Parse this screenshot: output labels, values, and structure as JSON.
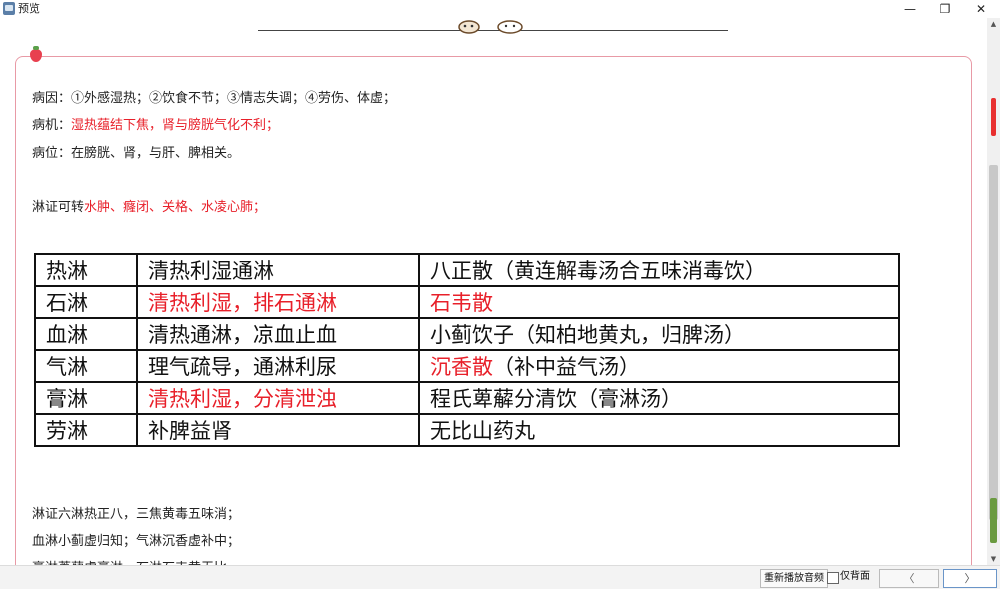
{
  "window": {
    "title": "预览",
    "minimize_glyph": "—",
    "restore_glyph": "❐",
    "close_glyph": "✕"
  },
  "lines": {
    "cause": "病因：①外感湿热；②饮食不节；③情志失调；④劳伤、体虚；",
    "mechanism_label": "病机：",
    "mechanism_value": "湿热蕴结下焦，肾与膀胱气化不利；",
    "location": "病位：在膀胱、肾，与肝、脾相关。",
    "transform_label": "淋证可转",
    "transform_value": "水肿、癃闭、关格、水凌心肺；",
    "mnemonic1": "淋证六淋热正八，三焦黄毒五味消；",
    "mnemonic2": "血淋小蓟虚归知；气淋沉香虚补中；",
    "mnemonic3": "膏淋萆薢虚膏淋，石淋石韦黄无比"
  },
  "table": {
    "rows": [
      {
        "name": "热淋",
        "method": "清热利湿通淋",
        "formula_main": "八正散",
        "formula_rest": "（黄连解毒汤合五味消毒饮）"
      },
      {
        "name": "石淋",
        "method": "清热利湿，排石通淋",
        "formula_main": "石韦散",
        "formula_rest": ""
      },
      {
        "name": "血淋",
        "method": "清热通淋，凉血止血",
        "formula_main": "小蓟饮子",
        "formula_rest": "（知柏地黄丸，归脾汤）"
      },
      {
        "name": "气淋",
        "method": "理气疏导，通淋利尿",
        "formula_main": "沉香散",
        "formula_rest": "（补中益气汤）"
      },
      {
        "name": "膏淋",
        "method": "清热利湿，分清泄浊",
        "formula_main": "程氏萆薢分清饮",
        "formula_rest": "（膏淋汤）"
      },
      {
        "name": "劳淋",
        "method": "补脾益肾",
        "formula_main": "无比山药丸",
        "formula_rest": ""
      }
    ]
  },
  "bottom": {
    "replay_label": "重新播放音频",
    "only_back_label": "仅背面",
    "prev_glyph": "〈",
    "next_glyph": "〉"
  },
  "scrollbar": {
    "up_glyph": "▲",
    "down_glyph": "▼"
  },
  "colors": {
    "highlight": "#e8202a",
    "card_border": "#e89aa6"
  }
}
